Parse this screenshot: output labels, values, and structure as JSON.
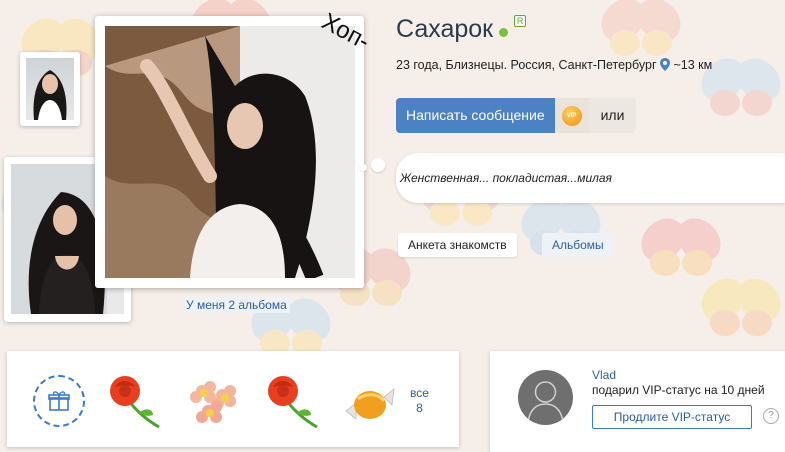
{
  "profile": {
    "hop_text": "Хоп-",
    "name": "Сахарок",
    "badge": "R",
    "meta": "23 года, Близнецы. Россия, Санкт-Петербург",
    "distance": "~13 км",
    "status_quote": "Женственная... покладистая...милая",
    "albums_link": "У меня 2 альбома"
  },
  "actions": {
    "message_button": "Написать сообщение",
    "vip_icon_text": "VIP",
    "or_label": "или"
  },
  "tabs": {
    "profile": "Анкета знакомств",
    "albums": "Альбомы"
  },
  "gifts": {
    "icons": [
      "rose-gift-icon",
      "flowers-gift-icon",
      "rose-gift-icon",
      "candy-gift-icon"
    ],
    "all_label": "все",
    "all_count": "8"
  },
  "vip": {
    "user": "Vlad",
    "text": "подарил VIP-статус на 10 дней",
    "button": "Продлите VIP-статус",
    "help": "?"
  },
  "colors": {
    "accent_blue": "#4c82c3",
    "link_blue": "#2b5fa5",
    "online_green": "#7bbf3a",
    "background": "#f6efe9"
  }
}
